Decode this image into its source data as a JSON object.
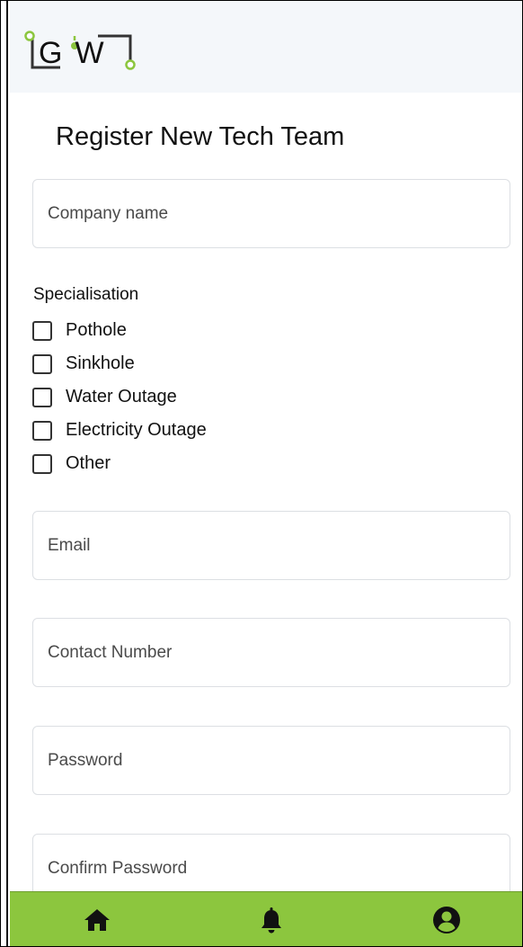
{
  "brand": {
    "logo_text": "GW",
    "accent_color": "#8cc63e",
    "header_color": "#f4f7fa"
  },
  "page": {
    "title": "Register New Tech Team"
  },
  "form": {
    "company_name": {
      "value": "",
      "placeholder": "Company name"
    },
    "specialisation": {
      "label": "Specialisation",
      "options": [
        {
          "label": "Pothole",
          "checked": false
        },
        {
          "label": "Sinkhole",
          "checked": false
        },
        {
          "label": "Water Outage",
          "checked": false
        },
        {
          "label": "Electricity Outage",
          "checked": false
        },
        {
          "label": "Other",
          "checked": false
        }
      ]
    },
    "email": {
      "value": "",
      "placeholder": "Email"
    },
    "contact_number": {
      "value": "",
      "placeholder": "Contact Number"
    },
    "password": {
      "value": "",
      "placeholder": "Password"
    },
    "confirm_password": {
      "value": "",
      "placeholder": "Confirm Password"
    }
  },
  "nav": {
    "items": [
      {
        "icon": "home-icon"
      },
      {
        "icon": "bell-icon"
      },
      {
        "icon": "user-circle-icon"
      }
    ]
  }
}
